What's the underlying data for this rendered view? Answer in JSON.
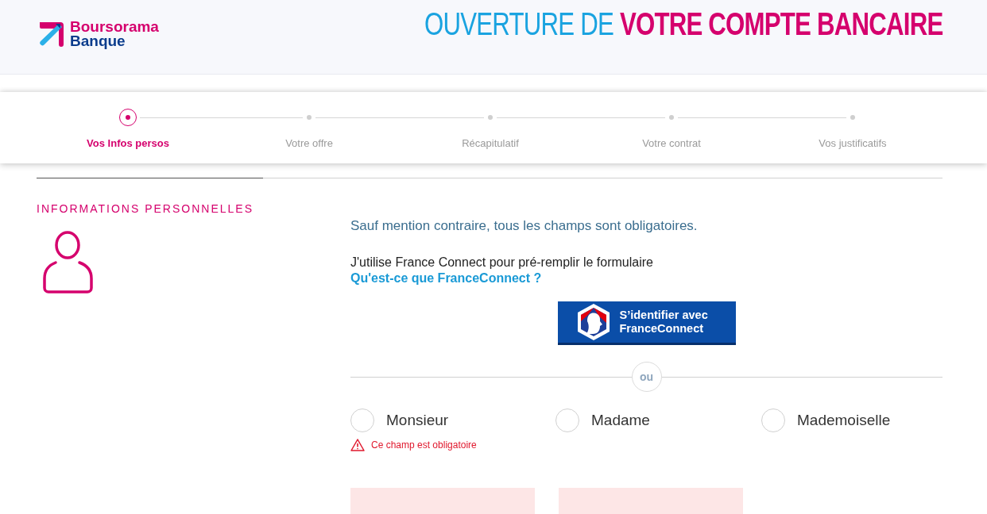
{
  "header": {
    "logo_line_1": "Boursorama",
    "logo_line_2": "Banque",
    "title": "OUVERTURE DE **VOTRE COMPTE BANCAIRE**"
  },
  "steps": [
    {
      "label": "Vos Infos persos",
      "selected": true
    },
    {
      "label": "Votre offre",
      "selected": false
    },
    {
      "label": "Récapitulatif",
      "selected": false
    },
    {
      "label": "Votre contrat",
      "selected": false
    },
    {
      "label": "Vos justificatifs",
      "selected": false
    }
  ],
  "section": {
    "heading": "INFORMATIONS PERSONNELLES"
  },
  "form": {
    "intro": "Sauf mention contraire, tous les champs sont obligatoires.",
    "france_connect_prompt": "J'utilise France Connect pour pré-remplir le formulaire",
    "france_connect_link": "Qu'est-ce que FranceConnect ?",
    "france_connect_button_line_1": "S’identifier avec",
    "france_connect_button_line_2": "FranceConnect",
    "divider_label": "ou",
    "civility": [
      {
        "label": "Monsieur",
        "selected": false
      },
      {
        "label": "Madame",
        "selected": false
      },
      {
        "label": "Mademoiselle",
        "selected": false
      }
    ],
    "civility_error": "Ce champ est obligatoire",
    "fields": [
      {
        "error": true
      },
      {
        "error": true
      }
    ]
  }
}
